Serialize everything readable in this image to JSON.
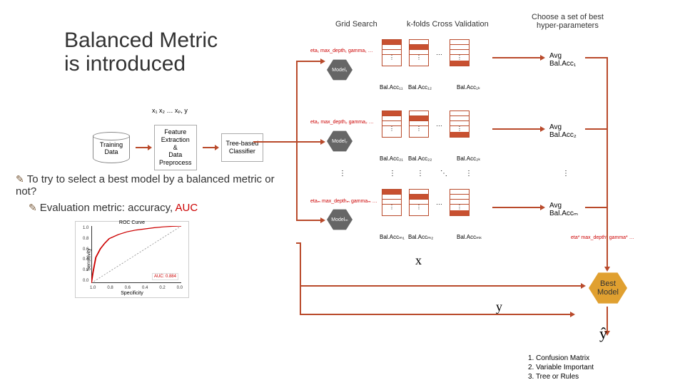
{
  "title_l1": "Balanced Metric",
  "title_l2": "is introduced",
  "bullet1": "To try to select a best model by a balanced metric or not?",
  "bullet2_a": "Evaluation metric: accuracy, ",
  "bullet2_b": "AUC",
  "vars": "x₁ x₂ … xₚ, y",
  "pipe": {
    "training": "Training\nData",
    "fe": "Feature\nExtraction\n&\nData\nPreprocess",
    "tb": "Tree-based\nClassifier"
  },
  "headers": {
    "grid": "Grid Search",
    "kfold": "k-folds Cross Validation",
    "choose": "Choose a set of best\nhyper-parameters"
  },
  "rows": [
    {
      "hp": "eta₁ max_depth₁ gamma₁ …",
      "model": "Model₁",
      "bal": [
        "Bal.Acc₁₁",
        "Bal.Acc₁₂",
        "Bal.Acc₁ₖ"
      ],
      "avg": "Avg\nBal.Acc₁"
    },
    {
      "hp": "eta₂ max_depth₂ gamma₂ …",
      "model": "Model₂",
      "bal": [
        "Bal.Acc₂₁",
        "Bal.Acc₂₂",
        "Bal.Acc₂ₖ"
      ],
      "avg": "Avg\nBal.Acc₂"
    },
    {
      "hp": "etaₘ max_depthₘ gammaₘ …",
      "model": "Modelₘ",
      "bal": [
        "Bal.Accₘ₁",
        "Bal.Accₘ₂",
        "Bal.Accₘₖ"
      ],
      "avg": "Avg\nBal.Accₘ"
    }
  ],
  "best_hp": "eta* max_depth* gamma* …",
  "best": "Best\nModel",
  "x": "x",
  "y": "y",
  "yhat": "ŷ",
  "ellipsis_h": "…",
  "ellipsis_v": "⋮",
  "ellipsis_d": "⋱",
  "roc": {
    "title": "ROC Curve",
    "xlabel": "Specificity",
    "ylabel": "Sensitivity",
    "legend": "AUC: 0.884",
    "xticks": [
      "1.0",
      "0.8",
      "0.6",
      "0.4",
      "0.2",
      "0.0"
    ],
    "yticks": [
      "0.0",
      "0.2",
      "0.4",
      "0.6",
      "0.8",
      "1.0"
    ]
  },
  "notes": [
    "1. Confusion Matrix",
    "2. Variable Important",
    "3. Tree or Rules"
  ],
  "chart_data": {
    "type": "line",
    "title": "ROC Curve",
    "xlabel": "Specificity",
    "ylabel": "Sensitivity",
    "xlim": [
      1.0,
      0.0
    ],
    "ylim": [
      0.0,
      1.0
    ],
    "series": [
      {
        "name": "AUC: 0.884",
        "x": [
          1.0,
          0.98,
          0.95,
          0.9,
          0.85,
          0.8,
          0.7,
          0.6,
          0.5,
          0.4,
          0.3,
          0.2,
          0.1,
          0.0
        ],
        "y": [
          0.0,
          0.2,
          0.45,
          0.6,
          0.7,
          0.78,
          0.85,
          0.9,
          0.93,
          0.95,
          0.97,
          0.985,
          0.995,
          1.0
        ]
      }
    ]
  }
}
